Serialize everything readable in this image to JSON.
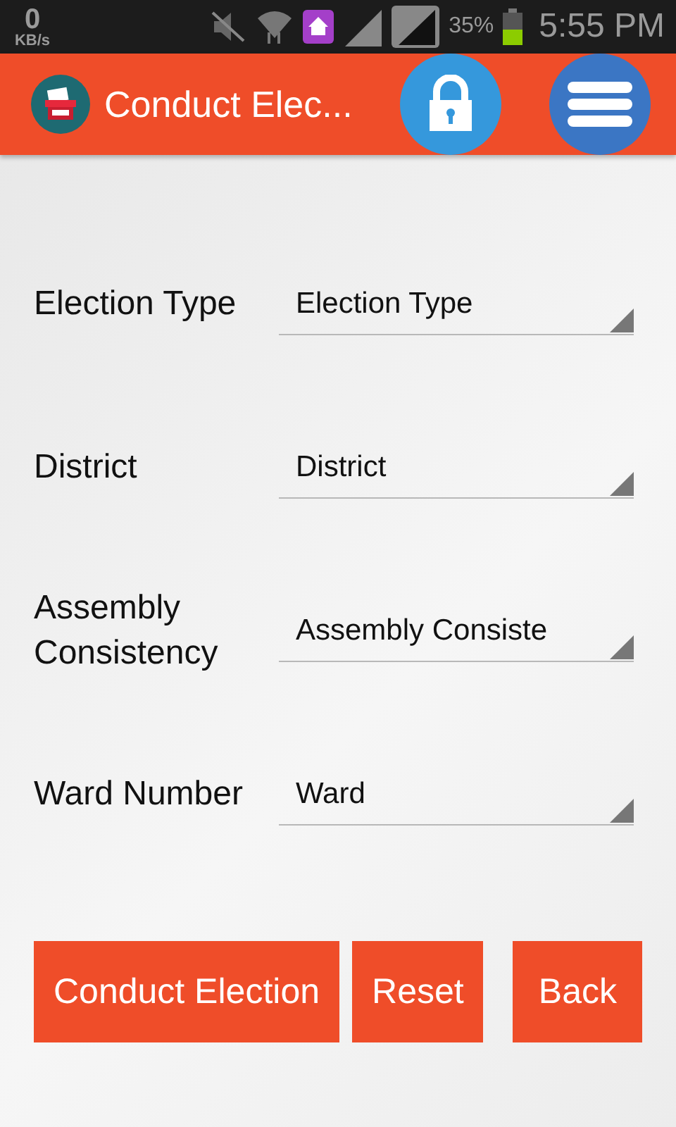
{
  "status_bar": {
    "speed": "0",
    "speed_unit": "KB/s",
    "battery": "35%",
    "time": "5:55 PM"
  },
  "app_bar": {
    "title": "Conduct Elec..."
  },
  "form": [
    {
      "label": "Election Type",
      "value": "Election Type"
    },
    {
      "label": "District",
      "value": "District"
    },
    {
      "label": "Assembly Consistency",
      "value": "Assembly Consiste"
    },
    {
      "label": "Ward Number",
      "value": "Ward"
    }
  ],
  "buttons": [
    "Conduct Election",
    "Reset",
    "Back"
  ]
}
